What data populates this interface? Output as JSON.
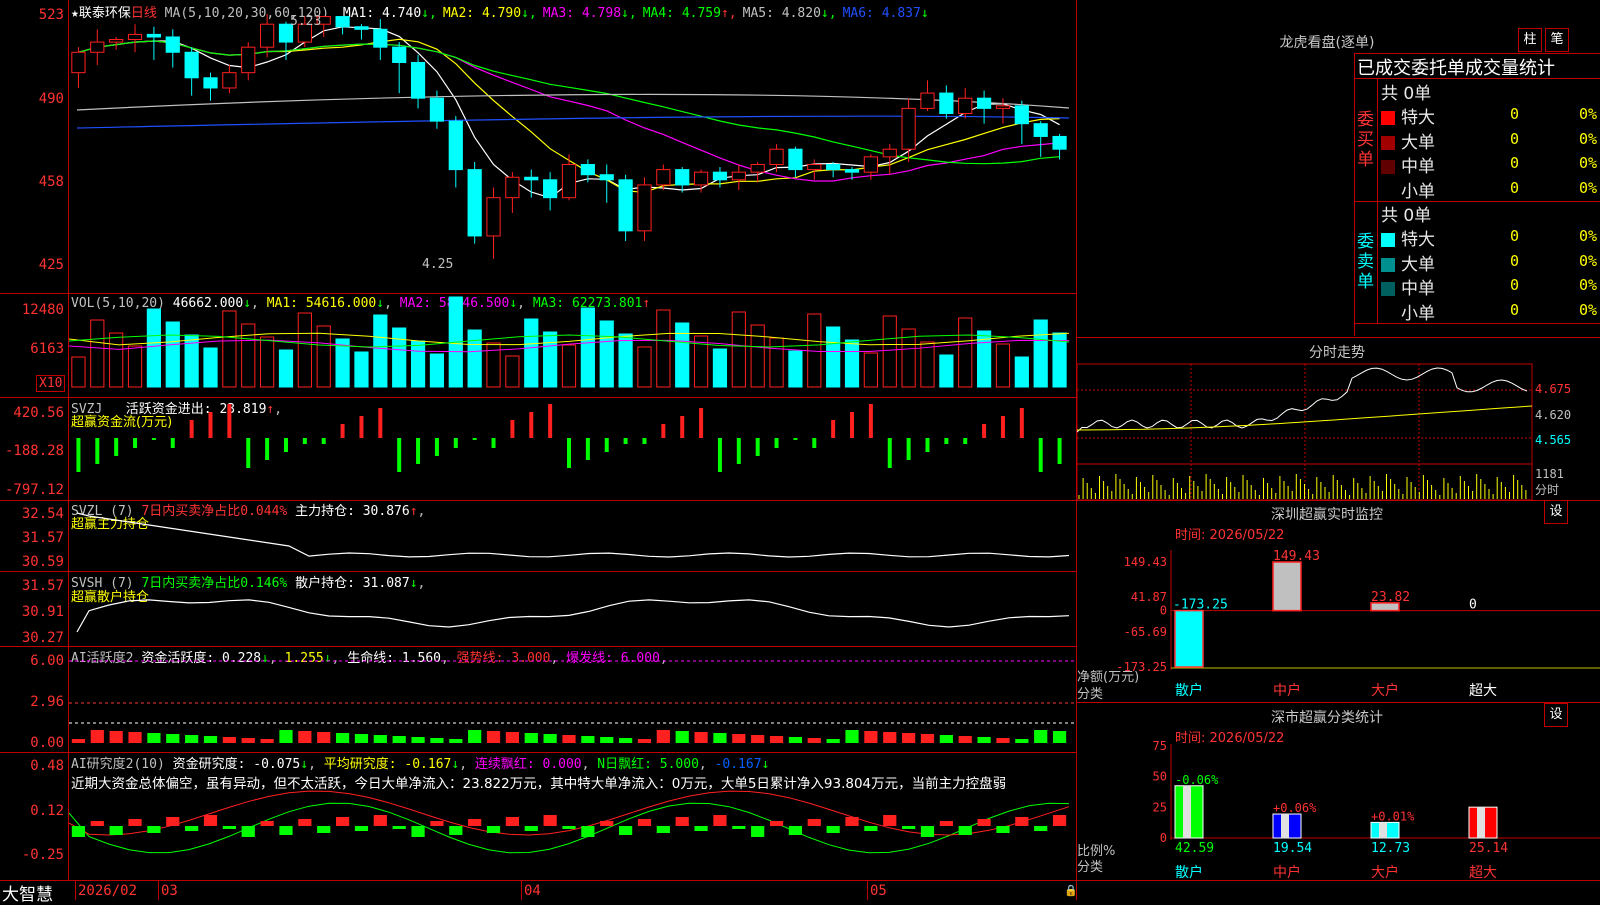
{
  "main": {
    "stock_name": "★联泰环保",
    "period": "日线",
    "ma_header": "MA(5,10,20,30,60,120)",
    "ma_items": [
      {
        "label": "MA1:",
        "value": "4.740",
        "arrow": "↓",
        "color": "#ffffff"
      },
      {
        "label": "MA2:",
        "value": "4.790",
        "arrow": "↓",
        "color": "#ffff00"
      },
      {
        "label": "MA3:",
        "value": "4.798",
        "arrow": "↓",
        "color": "#ff00ff"
      },
      {
        "label": "MA4:",
        "value": "4.759",
        "arrow": "↑",
        "color": "#00ff00"
      },
      {
        "label": "MA5:",
        "value": "4.820",
        "arrow": "↓",
        "color": "#c0c0c0"
      },
      {
        "label": "MA6:",
        "value": "4.837",
        "arrow": "↓",
        "color": "#2050ff"
      }
    ],
    "y_ticks": [
      "523",
      "490",
      "458",
      "425"
    ],
    "high_label": "5.23",
    "low_label": "4.25"
  },
  "vol": {
    "header": "VOL(5,10,20)",
    "value": "46662.000",
    "ma1": "MA1: 54616.000",
    "ma2": "MA2: 58846.500",
    "ma3": "MA3: 62273.801",
    "y_ticks": [
      "12480",
      "6163"
    ],
    "unit": "X10"
  },
  "svzj": {
    "header": "SVZJ",
    "label": "活跃资金进出: 23.819",
    "sub": "超赢资金流(万元)",
    "y_ticks": [
      "420.56",
      "-188.28",
      "-797.12"
    ]
  },
  "svzl": {
    "header": "SVZL (7)",
    "pct": "7日内买卖净占比0.044%",
    "label": "主力持仓: 30.876",
    "sub": "超赢主力持仓",
    "y_ticks": [
      "32.54",
      "31.57",
      "30.59"
    ]
  },
  "svsh": {
    "header": "SVSH (7)",
    "pct": "7日内买卖净占比0.146%",
    "label": "散户持仓: 31.087",
    "sub": "超赢散户持仓",
    "y_ticks": [
      "31.57",
      "30.91",
      "30.27"
    ]
  },
  "ai1": {
    "header": "AI活跃度2",
    "label": "资金活跃度: 0.228",
    "v2": "1.255",
    "life": "生命线: 1.560",
    "strong": "强势线: 3.000",
    "burst": "爆发线: 6.000",
    "y_ticks": [
      "6.00",
      "2.96",
      "0.00"
    ]
  },
  "ai2": {
    "header": "AI研究度2(10)",
    "label": "资金研究度: -0.075",
    "avg": "平均研究度: -0.167",
    "red": "连续飘红: 0.000",
    "nred": "N日飘红: 5.000",
    "last": "-0.167",
    "comment": "近期大资金总体偏空，虽有异动，但不太活跃，今日大单净流入：23.822万元，其中特大单净流入：0万元，大单5日累计净入93.804万元，当前主力控盘弱",
    "y_ticks": [
      "0.48",
      "0.12",
      "-0.25"
    ]
  },
  "bottom": {
    "brand": "大智慧",
    "dates": [
      "2026/02",
      "03",
      "04",
      "05"
    ]
  },
  "right": {
    "title": "龙虎看盘(逐单)",
    "btn_zhu": "柱",
    "btn_bi": "笔",
    "order_header": "已成交委托单成交量统计",
    "buy_group": "委买单",
    "sell_group": "委卖单",
    "buy_total": "共 0单",
    "sell_total": "共 0单",
    "buy_rows": [
      {
        "label": "特大",
        "vol": "0",
        "pct": "0%",
        "color": "#ff0000"
      },
      {
        "label": "大单",
        "vol": "0",
        "pct": "0%",
        "color": "#a00000"
      },
      {
        "label": "中单",
        "vol": "0",
        "pct": "0%",
        "color": "#600000"
      },
      {
        "label": "小单",
        "vol": "0",
        "pct": "0%",
        "color": "#000000"
      }
    ],
    "sell_rows": [
      {
        "label": "特大",
        "vol": "0",
        "pct": "0%",
        "color": "#00ffff"
      },
      {
        "label": "大单",
        "vol": "0",
        "pct": "0%",
        "color": "#009090"
      },
      {
        "label": "中单",
        "vol": "0",
        "pct": "0%",
        "color": "#006060"
      },
      {
        "label": "小单",
        "vol": "0",
        "pct": "0%",
        "color": "#000000"
      }
    ],
    "intraday_title": "分时走势",
    "intraday_prices": [
      "4.675",
      "4.620",
      "4.565"
    ],
    "intraday_vol": "1181",
    "intraday_vol_lbl": "分时",
    "sz_title": "深圳超赢实时监控",
    "sz_btn": "设",
    "sz_time": "时间: 2026/05/22",
    "sz_ticks": [
      "149.43",
      "41.87",
      "0",
      "-65.69",
      "-173.25"
    ],
    "sz_bars": [
      {
        "cat": "散户",
        "value": -173.25,
        "label": "-173.25"
      },
      {
        "cat": "中户",
        "value": 149.43,
        "label": "149.43"
      },
      {
        "cat": "大户",
        "value": 23.82,
        "label": "23.82"
      },
      {
        "cat": "超大",
        "value": 0,
        "label": "0"
      }
    ],
    "sz_ylabel": "净额(万元)",
    "sz_xlabel": "分类",
    "sc_title": "深市超赢分类统计",
    "sc_btn": "设",
    "sc_time": "时间: 2026/05/22",
    "sc_ticks": [
      "75",
      "50",
      "25",
      "0"
    ],
    "sc_bars": [
      {
        "cat": "散户",
        "value": 42.59,
        "delta": "-0.06%",
        "label": "42.59"
      },
      {
        "cat": "中户",
        "value": 19.54,
        "delta": "+0.06%",
        "label": "19.54"
      },
      {
        "cat": "大户",
        "value": 12.73,
        "delta": "+0.01%",
        "label": "12.73"
      },
      {
        "cat": "超大",
        "value": 25.14,
        "delta": "",
        "label": "25.14"
      }
    ],
    "sc_ylabel": "比例%",
    "sc_xlabel": "分类"
  },
  "colors": {
    "up": "#ff2020",
    "down": "#00ffff",
    "frame": "#c00000"
  },
  "chart_data": {
    "type": "candlestick",
    "candles": [
      [
        500,
        508,
        498,
        510,
        494
      ],
      [
        508,
        512,
        505,
        517,
        503
      ],
      [
        512,
        513,
        512,
        514,
        509
      ],
      [
        513,
        515,
        510,
        519,
        508
      ],
      [
        515,
        514,
        509,
        518,
        505
      ],
      [
        514,
        508,
        507,
        517,
        502
      ],
      [
        508,
        498,
        494,
        510,
        491
      ],
      [
        498,
        494,
        490,
        500,
        489
      ],
      [
        494,
        500,
        494,
        503,
        492
      ],
      [
        500,
        510,
        500,
        512,
        497
      ],
      [
        510,
        519,
        507,
        523,
        506
      ],
      [
        519,
        512,
        508,
        520,
        505
      ],
      [
        512,
        519,
        512,
        522,
        510
      ],
      [
        519,
        522,
        518,
        522,
        514
      ],
      [
        522,
        518,
        517,
        522,
        515
      ],
      [
        518,
        517,
        515,
        519,
        513
      ],
      [
        517,
        510,
        507,
        521,
        505
      ],
      [
        510,
        504,
        494,
        512,
        492
      ],
      [
        504,
        490,
        488,
        507,
        486
      ],
      [
        490,
        481,
        479,
        493,
        478
      ],
      [
        481,
        462,
        458,
        483,
        455
      ],
      [
        462,
        436,
        434,
        465,
        433
      ],
      [
        436,
        451,
        435,
        455,
        427
      ],
      [
        451,
        459,
        449,
        461,
        445
      ],
      [
        459,
        458,
        453,
        462,
        451
      ],
      [
        458,
        451,
        447,
        461,
        446
      ],
      [
        451,
        464,
        452,
        468,
        450
      ],
      [
        464,
        460,
        458,
        466,
        457
      ],
      [
        460,
        458,
        452,
        464,
        449
      ],
      [
        458,
        438,
        436,
        460,
        434
      ],
      [
        438,
        456,
        439,
        459,
        434
      ],
      [
        456,
        462,
        455,
        464,
        454
      ],
      [
        462,
        456,
        455,
        463,
        453
      ],
      [
        456,
        461,
        455,
        462,
        453
      ],
      [
        461,
        458,
        456,
        463,
        455
      ],
      [
        458,
        461,
        456,
        464,
        454
      ],
      [
        461,
        464,
        459,
        465,
        457
      ],
      [
        464,
        470,
        463,
        472,
        461
      ],
      [
        470,
        462,
        461,
        471,
        459
      ],
      [
        462,
        464,
        461,
        466,
        458
      ],
      [
        464,
        462,
        460,
        465,
        459
      ],
      [
        462,
        461,
        460,
        463,
        458
      ],
      [
        461,
        467,
        459,
        468,
        458
      ],
      [
        467,
        470,
        462,
        472,
        460
      ],
      [
        470,
        486,
        466,
        490,
        465
      ],
      [
        486,
        492,
        485,
        497,
        485
      ],
      [
        492,
        484,
        484,
        495,
        482
      ],
      [
        484,
        490,
        485,
        494,
        482
      ],
      [
        490,
        486,
        483,
        493,
        480
      ],
      [
        486,
        487,
        483,
        490,
        480
      ],
      [
        487,
        480,
        476,
        489,
        472
      ],
      [
        480,
        475,
        469,
        481,
        467
      ],
      [
        475,
        470,
        467,
        476,
        466
      ]
    ],
    "price_range": [
      425,
      523
    ]
  }
}
